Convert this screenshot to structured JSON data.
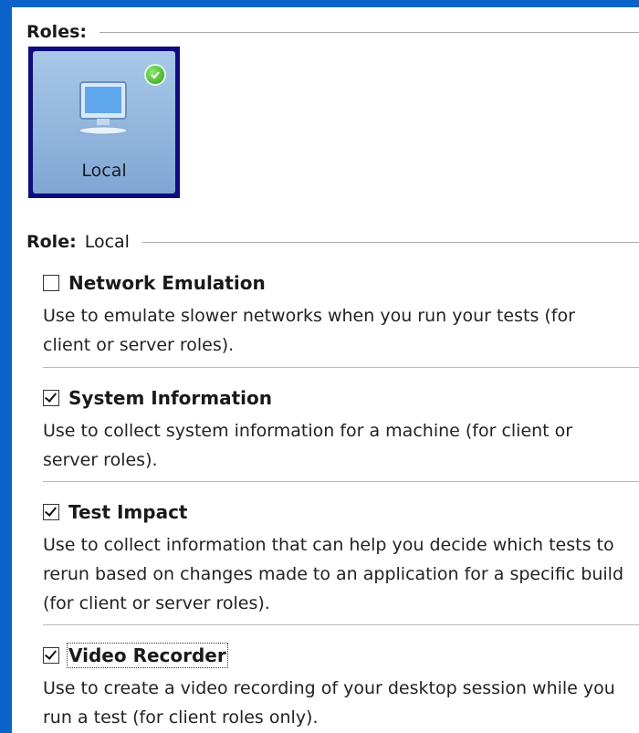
{
  "roles_header": {
    "label": "Roles:"
  },
  "role_tile": {
    "label": "Local",
    "icon": "monitor-icon",
    "status_icon": "green-check-icon"
  },
  "role_header": {
    "label": "Role:",
    "value": "Local"
  },
  "options": [
    {
      "title": "Network Emulation",
      "checked": false,
      "description": "Use to emulate slower networks when you run your tests (for client or server roles)."
    },
    {
      "title": "System Information",
      "checked": true,
      "description": "Use to collect system information for a machine (for client or server roles)."
    },
    {
      "title": "Test Impact",
      "checked": true,
      "description": "Use to collect information that can help you decide which tests to rerun based on changes made to an application for a specific build (for client or server roles)."
    },
    {
      "title": "Video Recorder",
      "checked": true,
      "description": "Use to create a video recording of your desktop session while you run a test (for client roles only)."
    }
  ]
}
